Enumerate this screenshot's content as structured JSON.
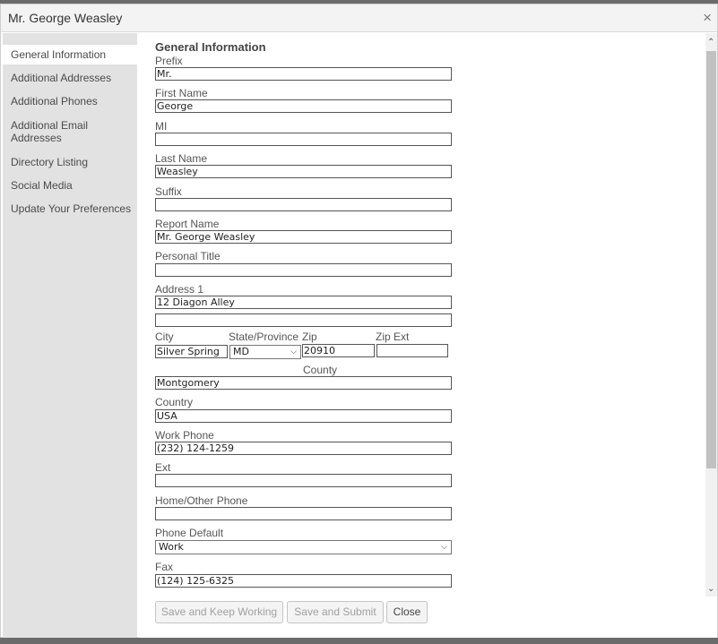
{
  "window": {
    "title": "Mr. George Weasley",
    "close_glyph": "×"
  },
  "sidebar": {
    "items": [
      {
        "label": "General Information",
        "active": true
      },
      {
        "label": "Additional Addresses"
      },
      {
        "label": "Additional Phones"
      },
      {
        "label": "Additional Email Addresses"
      },
      {
        "label": "Directory Listing"
      },
      {
        "label": "Social Media"
      },
      {
        "label": "Update Your Preferences"
      }
    ]
  },
  "form": {
    "section_title": "General Information",
    "prefix": {
      "label": "Prefix",
      "value": "Mr."
    },
    "first_name": {
      "label": "First Name",
      "value": "George"
    },
    "mi": {
      "label": "MI",
      "value": ""
    },
    "last_name": {
      "label": "Last Name",
      "value": "Weasley"
    },
    "suffix": {
      "label": "Suffix",
      "value": ""
    },
    "report_name": {
      "label": "Report Name",
      "value": "Mr. George Weasley"
    },
    "personal_title": {
      "label": "Personal Title",
      "value": ""
    },
    "address1": {
      "label": "Address 1",
      "value": "12 Diagon Alley"
    },
    "address2": {
      "value": ""
    },
    "city": {
      "label": "City",
      "value": "Silver Spring"
    },
    "state": {
      "label": "State/Province",
      "value": "MD"
    },
    "zip": {
      "label": "Zip",
      "value": "20910"
    },
    "zip_ext": {
      "label": "Zip Ext",
      "value": ""
    },
    "county": {
      "label": "County",
      "value": "Montgomery"
    },
    "country": {
      "label": "Country",
      "value": "USA"
    },
    "work_phone": {
      "label": "Work Phone",
      "value": "(232) 124-1259"
    },
    "ext": {
      "label": "Ext",
      "value": ""
    },
    "home_phone": {
      "label": "Home/Other Phone",
      "value": ""
    },
    "phone_default": {
      "label": "Phone Default",
      "value": "Work"
    },
    "fax": {
      "label": "Fax",
      "value": "(124) 125-6325"
    }
  },
  "buttons": {
    "save_keep": "Save and Keep Working",
    "save_submit": "Save and Submit",
    "close": "Close"
  },
  "icons": {
    "select_arrow": "⌵",
    "scroll_up": "⌃",
    "scroll_down": "⌄"
  }
}
